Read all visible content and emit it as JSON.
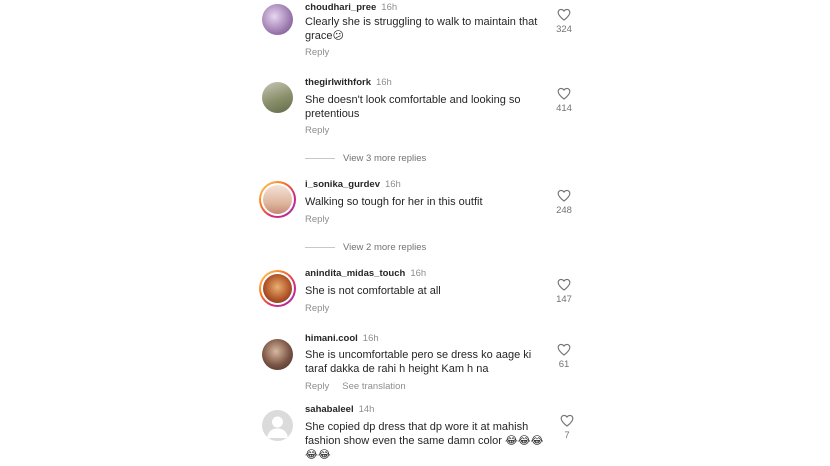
{
  "comments": [
    {
      "username": "choudhari_pree",
      "time": "16h",
      "text": "Clearly she is struggling to walk to maintain that grace😕",
      "reply_label": "Reply",
      "likes": "324"
    },
    {
      "username": "thegirlwithfork",
      "time": "16h",
      "text": "She doesn't look comfortable and looking so pretentious",
      "reply_label": "Reply",
      "likes": "414"
    },
    {
      "username": "i_sonika_gurdev",
      "time": "16h",
      "text": "Walking so tough for her in this outfit",
      "reply_label": "Reply",
      "likes": "248"
    },
    {
      "username": "anindita_midas_touch",
      "time": "16h",
      "text": "She is not comfortable at all",
      "reply_label": "Reply",
      "likes": "147"
    },
    {
      "username": "himani.cool",
      "time": "16h",
      "text": "She is uncomfortable pero se dress ko aage ki taraf dakka de rahi h height Kam h na",
      "reply_label": "Reply",
      "translation_label": "See translation",
      "likes": "61"
    },
    {
      "username": "sahabaleel",
      "time": "14h",
      "text": "She copied dp dress that dp wore it at mahish fashion show even the same damn color 😂😂😂😂😂",
      "likes": "7"
    }
  ],
  "view_more": [
    {
      "label": "View 3 more replies"
    },
    {
      "label": "View 2 more replies"
    }
  ],
  "icons": {
    "like": "heart-outline-icon"
  },
  "colors": {
    "text": "#262626",
    "secondary": "#8e8e8e",
    "story_ring": "#d62976"
  }
}
